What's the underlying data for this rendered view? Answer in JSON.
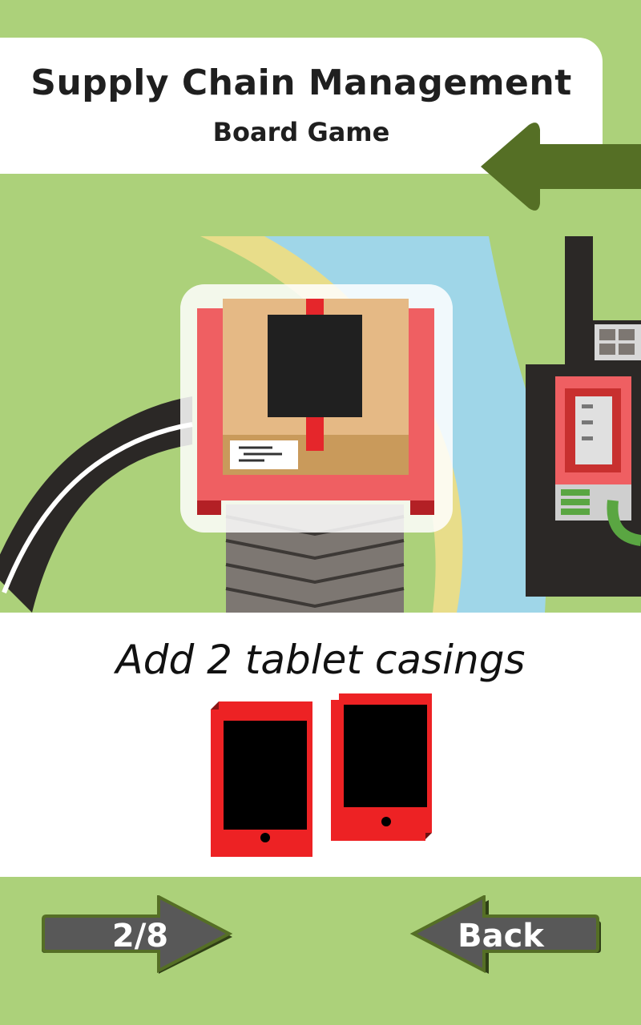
{
  "header": {
    "title": "Supply Chain Management",
    "subtitle": "Board Game"
  },
  "card": {
    "instruction": "Add 2 tablet casings",
    "item_count": 2
  },
  "nav": {
    "page_indicator": "2/8",
    "back_label": "Back"
  },
  "colors": {
    "background": "#acd17a",
    "arrow_green": "#556f25",
    "button_gray": "#585858",
    "tablet_red": "#ed2224"
  },
  "icons": {
    "top_arrow": "back-arrow-icon",
    "next": "next-arrow-button",
    "back": "back-arrow-button"
  }
}
